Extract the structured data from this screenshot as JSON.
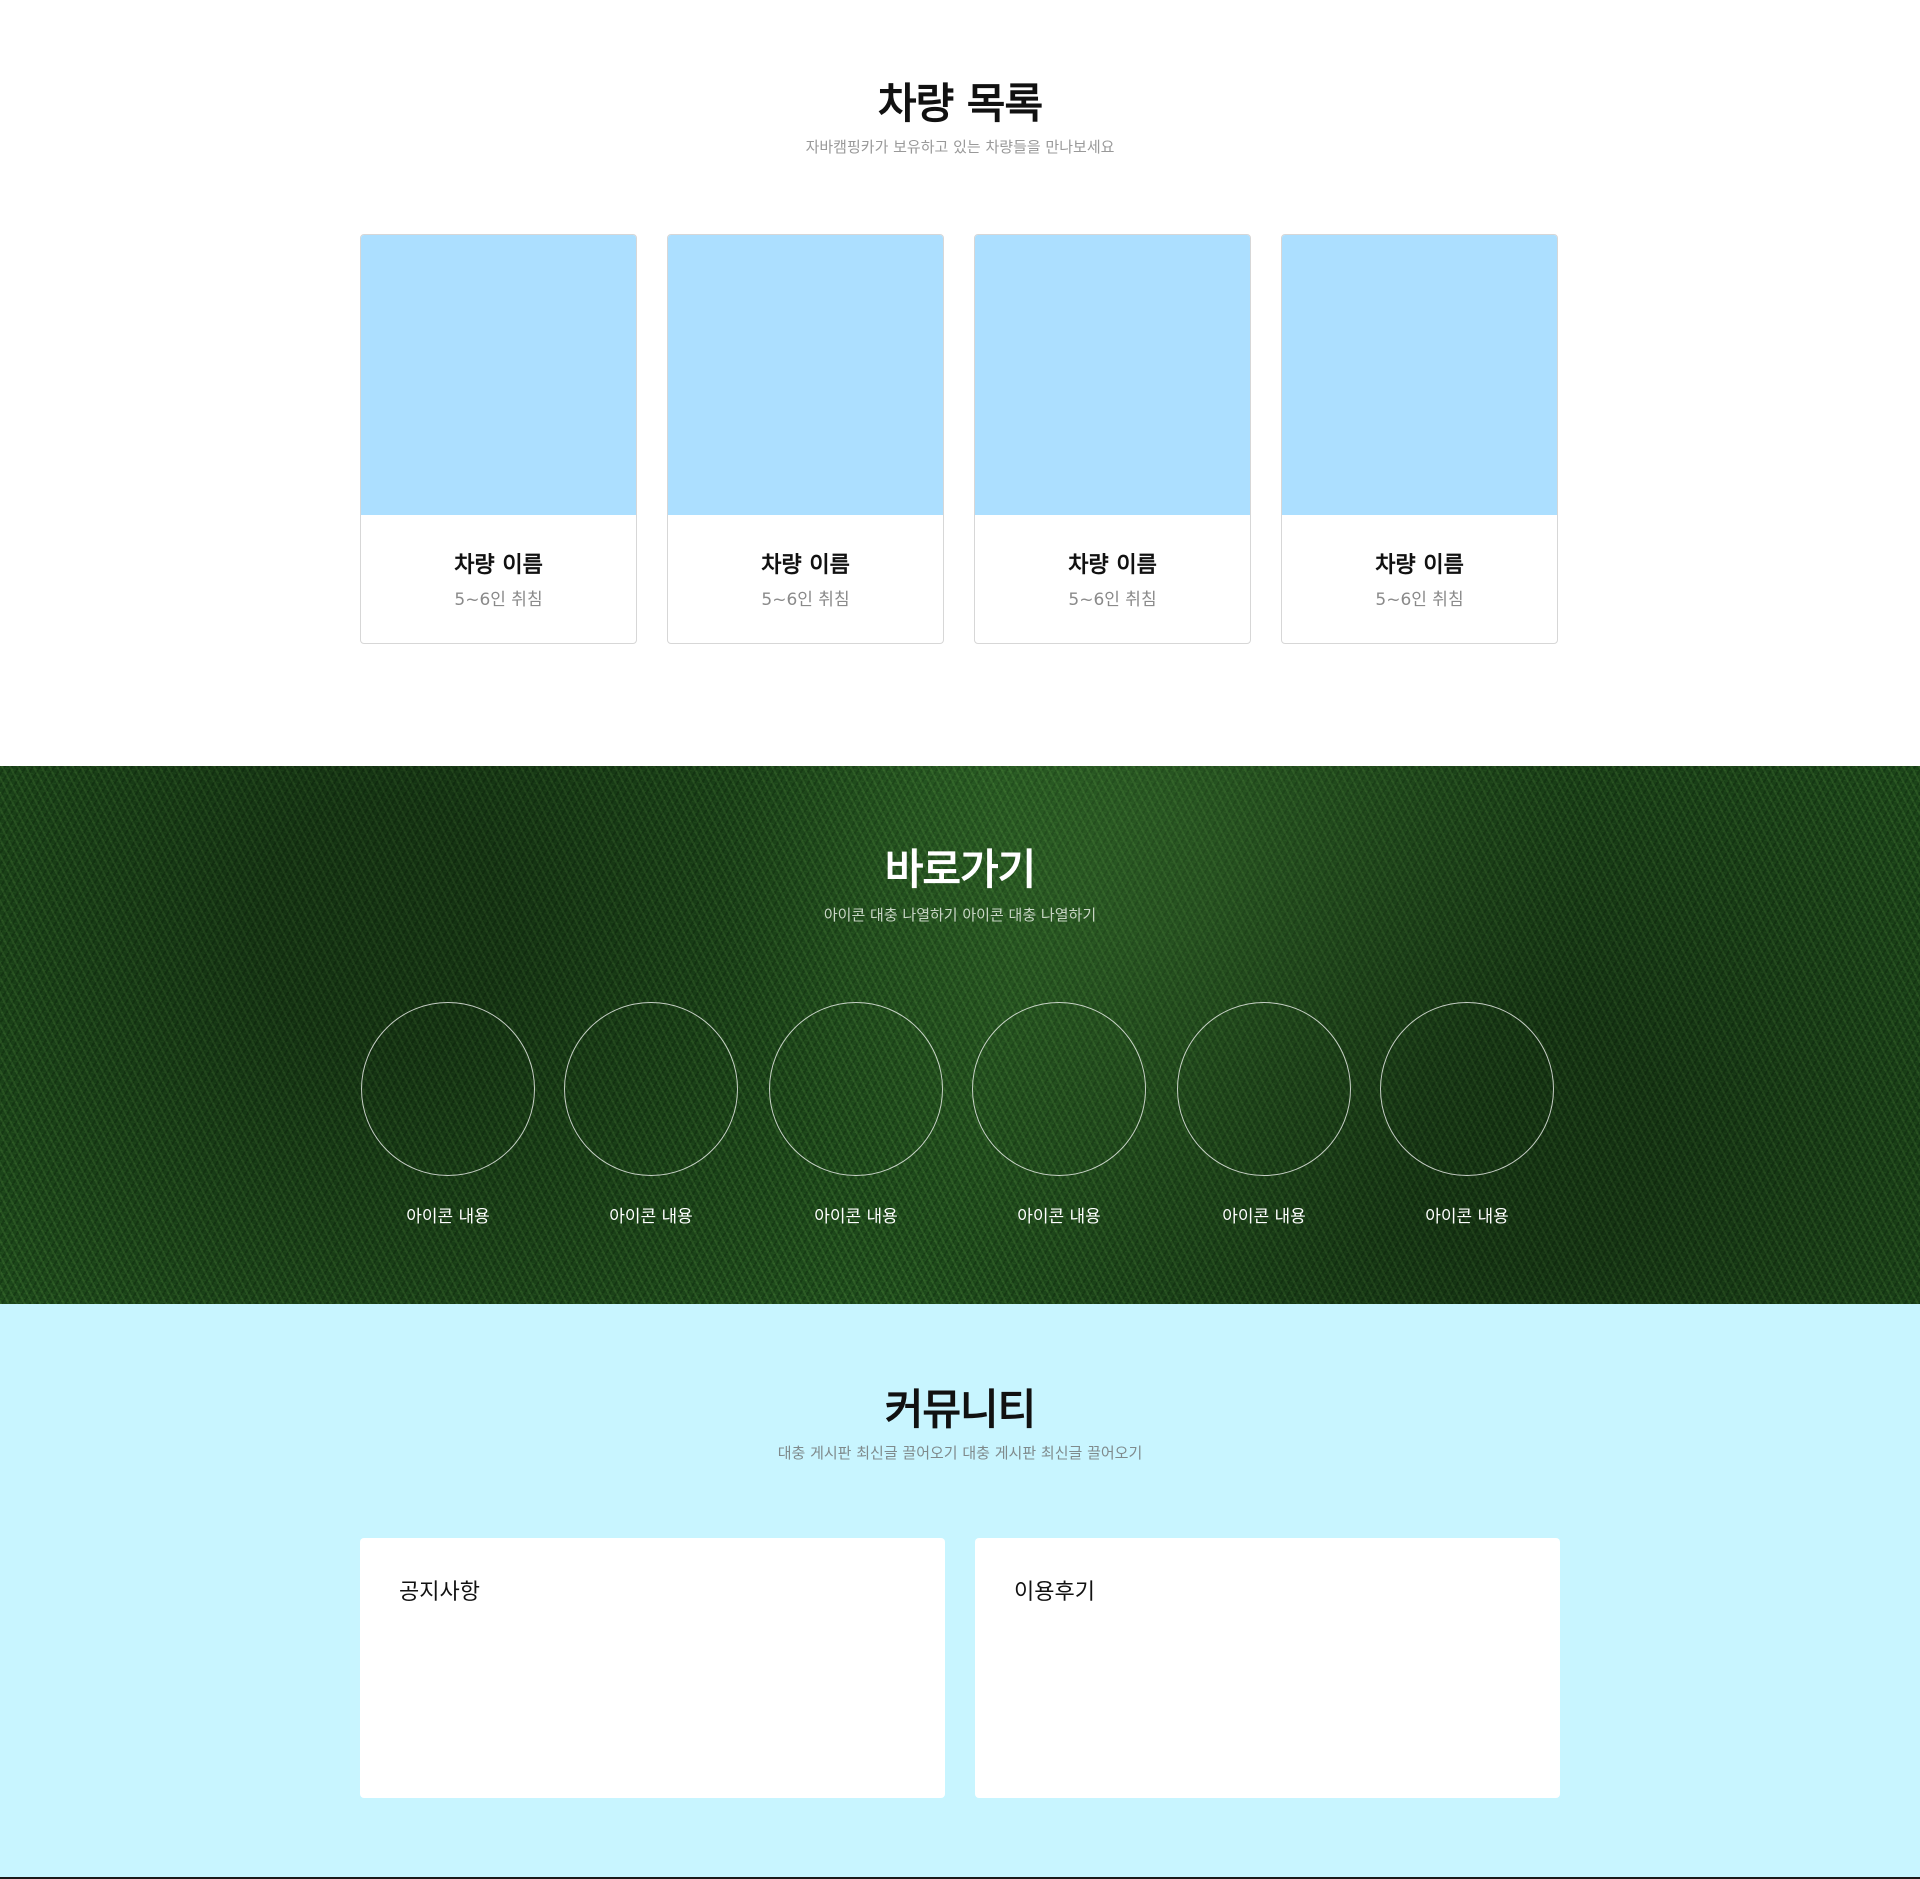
{
  "cars_section": {
    "title": "차량 목록",
    "subtitle": "자바캠핑카가 보유하고 있는 차량들을 만나보세요",
    "cards": [
      {
        "name": "차량 이름",
        "capacity": "5~6인 취침"
      },
      {
        "name": "차량 이름",
        "capacity": "5~6인 취침"
      },
      {
        "name": "차량 이름",
        "capacity": "5~6인 취침"
      },
      {
        "name": "차량 이름",
        "capacity": "5~6인 취침"
      }
    ],
    "image_placeholder_color": "#acdfff"
  },
  "shortcut_section": {
    "title": "바로가기",
    "subtitle": "아이콘 대충 나열하기 아이콘 대충 나열하기",
    "items": [
      {
        "label": "아이콘 내용"
      },
      {
        "label": "아이콘 내용"
      },
      {
        "label": "아이콘 내용"
      },
      {
        "label": "아이콘 내용"
      },
      {
        "label": "아이콘 내용"
      },
      {
        "label": "아이콘 내용"
      }
    ]
  },
  "community_section": {
    "title": "커뮤니티",
    "subtitle": "대충 게시판 최신글 끌어오기 대충 게시판 최신글 끌어오기",
    "boards": [
      {
        "title": "공지사항"
      },
      {
        "title": "이용후기"
      }
    ],
    "background_color": "#c8f5ff"
  }
}
